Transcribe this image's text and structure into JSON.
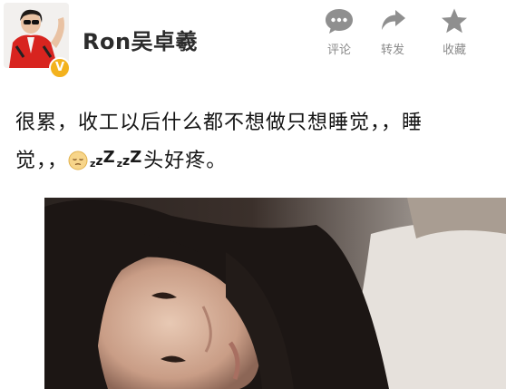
{
  "user": {
    "name": "Ron吴卓羲",
    "verified_badge": "V",
    "avatar_icon": "user-avatar"
  },
  "actions": {
    "comment_label": "评论",
    "repost_label": "转发",
    "favorite_label": "收藏"
  },
  "post": {
    "line1": "很累，收工以后什么都不想做只想睡觉，，睡",
    "line2_prefix": "觉，，",
    "line2_suffix": "头好疼。",
    "emoji": "sleepy-face-icon",
    "zzz_1": "zzZ",
    "zzz_2": "zzZ"
  },
  "colors": {
    "badge": "#f3b21e",
    "action_icon": "#8f8f8f",
    "text": "#141414"
  }
}
